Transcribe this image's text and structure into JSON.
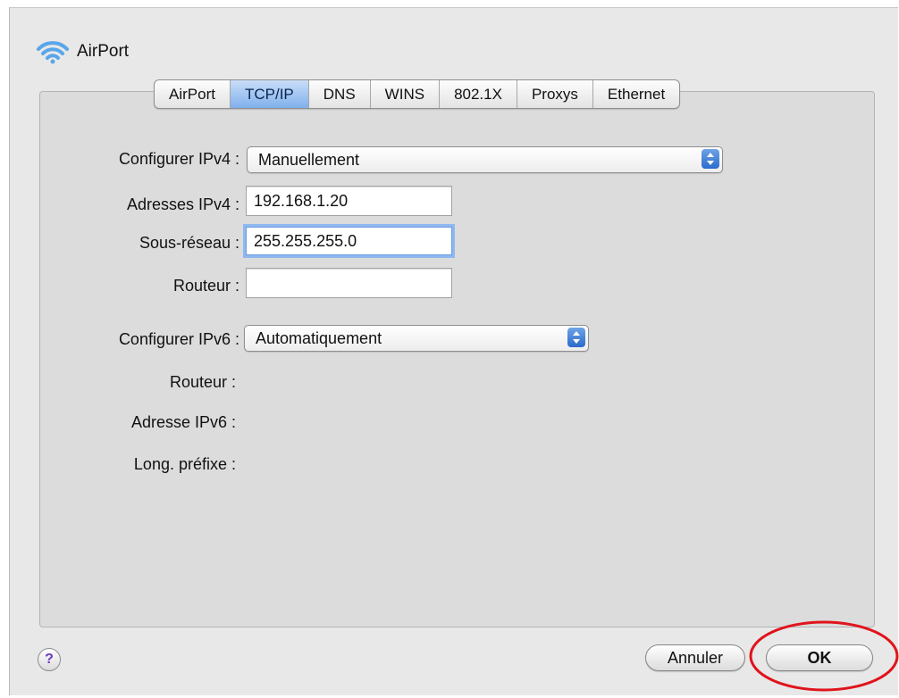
{
  "window": {
    "title": "AirPort"
  },
  "tabs": [
    {
      "label": "AirPort",
      "active": false
    },
    {
      "label": "TCP/IP",
      "active": true
    },
    {
      "label": "DNS",
      "active": false
    },
    {
      "label": "WINS",
      "active": false
    },
    {
      "label": "802.1X",
      "active": false
    },
    {
      "label": "Proxys",
      "active": false
    },
    {
      "label": "Ethernet",
      "active": false
    }
  ],
  "ipv4": {
    "configure_label": "Configurer IPv4 :",
    "configure_value": "Manuellement",
    "address_label": "Adresses IPv4 :",
    "address_value": "192.168.1.20",
    "subnet_label": "Sous-réseau :",
    "subnet_value": "255.255.255.0",
    "router_label": "Routeur :",
    "router_value": ""
  },
  "ipv6": {
    "configure_label": "Configurer IPv6 :",
    "configure_value": "Automatiquement",
    "router_label": "Routeur :",
    "address_label": "Adresse IPv6 :",
    "prefix_label": "Long. préfixe :"
  },
  "footer": {
    "help_glyph": "?",
    "cancel_label": "Annuler",
    "ok_label": "OK"
  },
  "colors": {
    "tab_active": "#7fb0ec",
    "highlight": "#e0141c",
    "focus_ring": "#8fb8ef"
  },
  "icons": {
    "title": "wifi-icon",
    "help": "help-icon"
  }
}
